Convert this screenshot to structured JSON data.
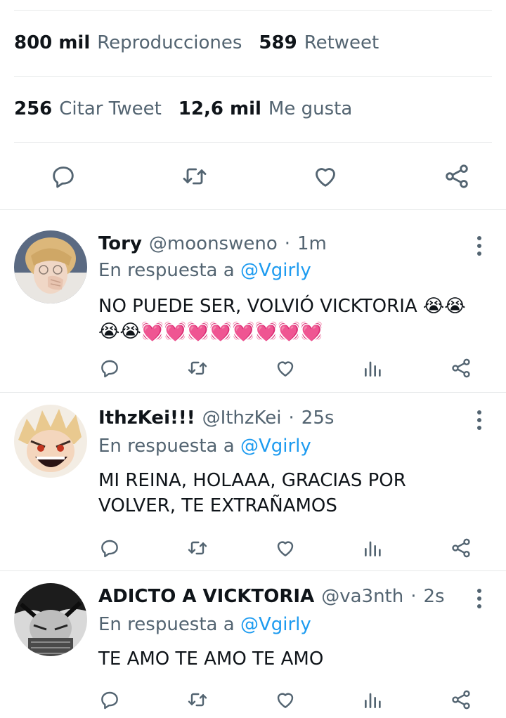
{
  "stats": {
    "row1": [
      {
        "value": "800 mil",
        "label": "Reproducciones"
      },
      {
        "value": "589",
        "label": "Retweet"
      }
    ],
    "row2": [
      {
        "value": "256",
        "label": "Citar Tweet"
      },
      {
        "value": "12,6 mil",
        "label": "Me gusta"
      }
    ]
  },
  "colors": {
    "text": "#0f1419",
    "muted": "#536471",
    "accent": "#1d9bf0",
    "divider": "#e7e9ea"
  },
  "action_icons": [
    "reply-icon",
    "retweet-icon",
    "like-icon",
    "share-icon"
  ],
  "reply_action_icons": [
    "reply-icon",
    "retweet-icon",
    "like-icon",
    "views-icon",
    "share-icon"
  ],
  "replies": [
    {
      "name": "Tory",
      "handle": "@moonsweno",
      "separator": "·",
      "time": "1m",
      "in_reply_prefix": "En respuesta a ",
      "in_reply_mention": "@Vgirly",
      "text": "NO PUEDE SER, VOLVIÓ VICKTORIA 😭😭😭😭💓💓💓💓💓💓💓💓"
    },
    {
      "name": "IthzKei!!!",
      "handle": "@IthzKei",
      "separator": "·",
      "time": "25s",
      "in_reply_prefix": "En respuesta a ",
      "in_reply_mention": "@Vgirly",
      "text": "MI REINA, HOLAAA, GRACIAS POR VOLVER, TE EXTRAÑAMOS"
    },
    {
      "name": "ADICTO A VICKTORIA",
      "handle": "@va3nth",
      "separator": "·",
      "time": "2s",
      "in_reply_prefix": "En respuesta a ",
      "in_reply_mention": "@Vgirly",
      "text": "TE AMO TE AMO TE AMO"
    }
  ]
}
